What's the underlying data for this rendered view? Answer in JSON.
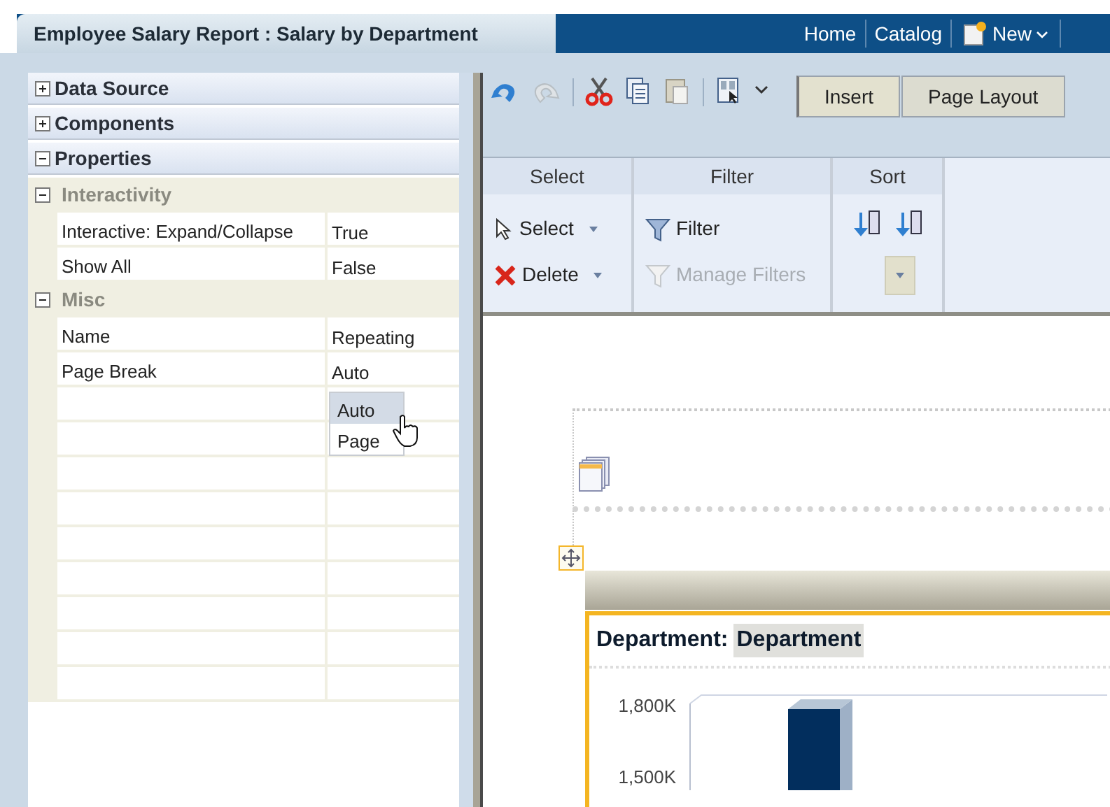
{
  "title_tab": {
    "title": "Employee Salary Report : Salary by Department"
  },
  "nav": [
    {
      "label": "Home",
      "kind": "link"
    },
    {
      "label": "Catalog",
      "kind": "link"
    },
    {
      "label": "New",
      "kind": "menu"
    }
  ],
  "accordion": [
    {
      "label": "Data Source",
      "expanded": false
    },
    {
      "label": "Components",
      "expanded": false
    },
    {
      "label": "Properties",
      "expanded": true
    }
  ],
  "property_groups": [
    {
      "label": "Interactivity",
      "expanded": true,
      "rows": [
        {
          "name": "Interactive: Expand/Collapse",
          "value": "True"
        },
        {
          "name": "Show All",
          "value": "False"
        }
      ]
    },
    {
      "label": "Misc",
      "expanded": true,
      "rows": [
        {
          "name": "Name",
          "value": "Repeating"
        },
        {
          "name": "Page Break",
          "value": "Auto"
        }
      ]
    }
  ],
  "dropdown_options": [
    {
      "label": "Auto",
      "selected": true
    },
    {
      "label": "Page",
      "selected": false
    }
  ],
  "tabs": [
    {
      "label": "Insert",
      "selected": true
    },
    {
      "label": "Page Layout",
      "selected": false
    }
  ],
  "ribbon": {
    "groups": [
      {
        "title": "Select",
        "items": [
          {
            "label": "Select",
            "kind": "select",
            "disabled": false
          },
          {
            "label": "Delete",
            "kind": "delete",
            "disabled": false
          }
        ]
      },
      {
        "title": "Filter",
        "items": [
          {
            "label": "Filter",
            "kind": "filter",
            "disabled": false
          },
          {
            "label": "Manage Filters",
            "kind": "filter",
            "disabled": true
          }
        ]
      },
      {
        "title": "Sort"
      }
    ]
  },
  "canvas": {
    "section_label": "Department:",
    "section_value": "Department",
    "chart_labels": [
      "1,800K",
      "1,500K"
    ]
  }
}
